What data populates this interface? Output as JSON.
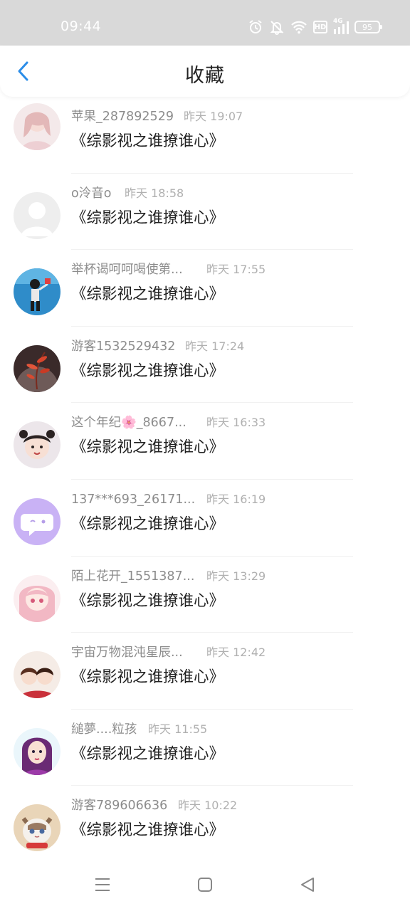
{
  "status_bar": {
    "time": "09:44",
    "battery": "95",
    "network": "4G",
    "hd": "HD"
  },
  "header": {
    "title": "收藏"
  },
  "items": [
    {
      "name": "苹果_287892529",
      "time": "昨天 19:07",
      "title": "《综影视之谁撩谁心》"
    },
    {
      "name": "o泠音o",
      "time": "昨天 18:58",
      "title": "《综影视之谁撩谁心》"
    },
    {
      "name": "举杯谒呵呵喝使第...",
      "time": "昨天 17:55",
      "title": "《综影视之谁撩谁心》"
    },
    {
      "name": "游客1532529432",
      "time": "昨天 17:24",
      "title": "《综影视之谁撩谁心》"
    },
    {
      "name": "这个年纪🌸_8667...",
      "time": "昨天 16:33",
      "title": "《综影视之谁撩谁心》"
    },
    {
      "name": "137***693_26171...",
      "time": "昨天 16:19",
      "title": "《综影视之谁撩谁心》"
    },
    {
      "name": "陌上花开_1551387...",
      "time": "昨天 13:29",
      "title": "《综影视之谁撩谁心》"
    },
    {
      "name": "宇宙万物混沌星辰...",
      "time": "昨天 12:42",
      "title": "《综影视之谁撩谁心》"
    },
    {
      "name": "縋夢....粒孩",
      "time": "昨天 11:55",
      "title": "《综影视之谁撩谁心》"
    },
    {
      "name": "游客789606636",
      "time": "昨天 10:22",
      "title": "《综影视之谁撩谁心》"
    }
  ],
  "colors": {
    "accent": "#2b8de8",
    "status_bar": "#d9d9d9",
    "chat_avatar": "#c9b2f5"
  },
  "icons": {
    "back": "chevron-left-icon",
    "alarm": "alarm-icon",
    "mute": "bell-off-icon",
    "wifi": "wifi-icon",
    "signal": "signal-icon",
    "menu": "menu-icon",
    "home": "home-icon",
    "back_nav": "triangle-back-icon"
  }
}
